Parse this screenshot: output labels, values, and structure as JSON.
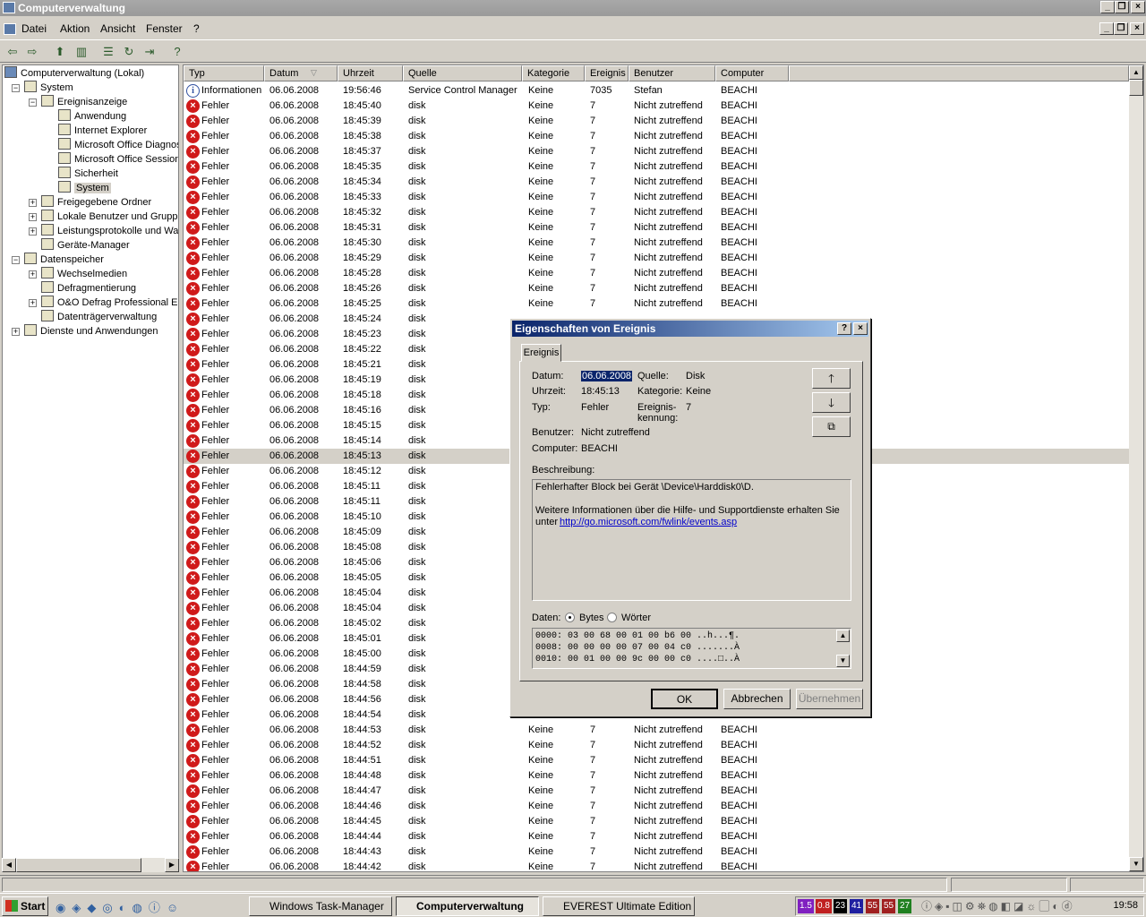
{
  "window": {
    "title": "Computerverwaltung"
  },
  "menu": [
    "Datei",
    "Aktion",
    "Ansicht",
    "Fenster",
    "?"
  ],
  "tree": {
    "root": "Computerverwaltung (Lokal)",
    "items": [
      {
        "label": "System",
        "level": 1,
        "expander": "−"
      },
      {
        "label": "Ereignisanzeige",
        "level": 2,
        "expander": "−"
      },
      {
        "label": "Anwendung",
        "level": 3
      },
      {
        "label": "Internet Explorer",
        "level": 3
      },
      {
        "label": "Microsoft Office Diagnos",
        "level": 3
      },
      {
        "label": "Microsoft Office Sessions",
        "level": 3
      },
      {
        "label": "Sicherheit",
        "level": 3
      },
      {
        "label": "System",
        "level": 3,
        "selected": true
      },
      {
        "label": "Freigegebene Ordner",
        "level": 2,
        "expander": "+"
      },
      {
        "label": "Lokale Benutzer und Gruppen",
        "level": 2,
        "expander": "+"
      },
      {
        "label": "Leistungsprotokolle und Warn",
        "level": 2,
        "expander": "+"
      },
      {
        "label": "Geräte-Manager",
        "level": 2
      },
      {
        "label": "Datenspeicher",
        "level": 1,
        "expander": "−"
      },
      {
        "label": "Wechselmedien",
        "level": 2,
        "expander": "+"
      },
      {
        "label": "Defragmentierung",
        "level": 2
      },
      {
        "label": "O&O Defrag Professional Edi",
        "level": 2,
        "expander": "+"
      },
      {
        "label": "Datenträgerverwaltung",
        "level": 2
      },
      {
        "label": "Dienste und Anwendungen",
        "level": 1,
        "expander": "+"
      }
    ]
  },
  "columns": [
    "Typ",
    "Datum",
    "Uhrzeit",
    "Quelle",
    "Kategorie",
    "Ereignis",
    "Benutzer",
    "Computer"
  ],
  "events": [
    [
      "Informationen",
      "06.06.2008",
      "19:56:46",
      "Service Control Manager",
      "Keine",
      "7035",
      "Stefan",
      "BEACHI"
    ],
    [
      "Fehler",
      "06.06.2008",
      "18:45:40",
      "disk",
      "Keine",
      "7",
      "Nicht zutreffend",
      "BEACHI"
    ],
    [
      "Fehler",
      "06.06.2008",
      "18:45:39",
      "disk",
      "Keine",
      "7",
      "Nicht zutreffend",
      "BEACHI"
    ],
    [
      "Fehler",
      "06.06.2008",
      "18:45:38",
      "disk",
      "Keine",
      "7",
      "Nicht zutreffend",
      "BEACHI"
    ],
    [
      "Fehler",
      "06.06.2008",
      "18:45:37",
      "disk",
      "Keine",
      "7",
      "Nicht zutreffend",
      "BEACHI"
    ],
    [
      "Fehler",
      "06.06.2008",
      "18:45:35",
      "disk",
      "Keine",
      "7",
      "Nicht zutreffend",
      "BEACHI"
    ],
    [
      "Fehler",
      "06.06.2008",
      "18:45:34",
      "disk",
      "Keine",
      "7",
      "Nicht zutreffend",
      "BEACHI"
    ],
    [
      "Fehler",
      "06.06.2008",
      "18:45:33",
      "disk",
      "Keine",
      "7",
      "Nicht zutreffend",
      "BEACHI"
    ],
    [
      "Fehler",
      "06.06.2008",
      "18:45:32",
      "disk",
      "Keine",
      "7",
      "Nicht zutreffend",
      "BEACHI"
    ],
    [
      "Fehler",
      "06.06.2008",
      "18:45:31",
      "disk",
      "Keine",
      "7",
      "Nicht zutreffend",
      "BEACHI"
    ],
    [
      "Fehler",
      "06.06.2008",
      "18:45:30",
      "disk",
      "Keine",
      "7",
      "Nicht zutreffend",
      "BEACHI"
    ],
    [
      "Fehler",
      "06.06.2008",
      "18:45:29",
      "disk",
      "Keine",
      "7",
      "Nicht zutreffend",
      "BEACHI"
    ],
    [
      "Fehler",
      "06.06.2008",
      "18:45:28",
      "disk",
      "Keine",
      "7",
      "Nicht zutreffend",
      "BEACHI"
    ],
    [
      "Fehler",
      "06.06.2008",
      "18:45:26",
      "disk",
      "Keine",
      "7",
      "Nicht zutreffend",
      "BEACHI"
    ],
    [
      "Fehler",
      "06.06.2008",
      "18:45:25",
      "disk",
      "Keine",
      "7",
      "Nicht zutreffend",
      "BEACHI"
    ],
    [
      "Fehler",
      "06.06.2008",
      "18:45:24",
      "disk",
      "",
      "",
      "",
      ""
    ],
    [
      "Fehler",
      "06.06.2008",
      "18:45:23",
      "disk",
      "",
      "",
      "",
      ""
    ],
    [
      "Fehler",
      "06.06.2008",
      "18:45:22",
      "disk",
      "",
      "",
      "",
      ""
    ],
    [
      "Fehler",
      "06.06.2008",
      "18:45:21",
      "disk",
      "",
      "",
      "",
      ""
    ],
    [
      "Fehler",
      "06.06.2008",
      "18:45:19",
      "disk",
      "",
      "",
      "",
      ""
    ],
    [
      "Fehler",
      "06.06.2008",
      "18:45:18",
      "disk",
      "",
      "",
      "",
      ""
    ],
    [
      "Fehler",
      "06.06.2008",
      "18:45:16",
      "disk",
      "",
      "",
      "",
      ""
    ],
    [
      "Fehler",
      "06.06.2008",
      "18:45:15",
      "disk",
      "",
      "",
      "",
      ""
    ],
    [
      "Fehler",
      "06.06.2008",
      "18:45:14",
      "disk",
      "",
      "",
      "",
      ""
    ],
    [
      "Fehler",
      "06.06.2008",
      "18:45:13",
      "disk",
      "",
      "",
      "",
      ""
    ],
    [
      "Fehler",
      "06.06.2008",
      "18:45:12",
      "disk",
      "",
      "",
      "",
      ""
    ],
    [
      "Fehler",
      "06.06.2008",
      "18:45:11",
      "disk",
      "",
      "",
      "",
      ""
    ],
    [
      "Fehler",
      "06.06.2008",
      "18:45:11",
      "disk",
      "",
      "",
      "",
      ""
    ],
    [
      "Fehler",
      "06.06.2008",
      "18:45:10",
      "disk",
      "",
      "",
      "",
      ""
    ],
    [
      "Fehler",
      "06.06.2008",
      "18:45:09",
      "disk",
      "",
      "",
      "",
      ""
    ],
    [
      "Fehler",
      "06.06.2008",
      "18:45:08",
      "disk",
      "",
      "",
      "",
      ""
    ],
    [
      "Fehler",
      "06.06.2008",
      "18:45:06",
      "disk",
      "",
      "",
      "",
      ""
    ],
    [
      "Fehler",
      "06.06.2008",
      "18:45:05",
      "disk",
      "",
      "",
      "",
      ""
    ],
    [
      "Fehler",
      "06.06.2008",
      "18:45:04",
      "disk",
      "",
      "",
      "",
      ""
    ],
    [
      "Fehler",
      "06.06.2008",
      "18:45:04",
      "disk",
      "",
      "",
      "",
      ""
    ],
    [
      "Fehler",
      "06.06.2008",
      "18:45:02",
      "disk",
      "",
      "",
      "",
      ""
    ],
    [
      "Fehler",
      "06.06.2008",
      "18:45:01",
      "disk",
      "",
      "",
      "",
      ""
    ],
    [
      "Fehler",
      "06.06.2008",
      "18:45:00",
      "disk",
      "",
      "",
      "",
      ""
    ],
    [
      "Fehler",
      "06.06.2008",
      "18:44:59",
      "disk",
      "",
      "",
      "",
      ""
    ],
    [
      "Fehler",
      "06.06.2008",
      "18:44:58",
      "disk",
      "",
      "",
      "",
      ""
    ],
    [
      "Fehler",
      "06.06.2008",
      "18:44:56",
      "disk",
      "",
      "",
      "",
      ""
    ],
    [
      "Fehler",
      "06.06.2008",
      "18:44:54",
      "disk",
      "",
      "",
      "",
      ""
    ],
    [
      "Fehler",
      "06.06.2008",
      "18:44:53",
      "disk",
      "Keine",
      "7",
      "Nicht zutreffend",
      "BEACHI"
    ],
    [
      "Fehler",
      "06.06.2008",
      "18:44:52",
      "disk",
      "Keine",
      "7",
      "Nicht zutreffend",
      "BEACHI"
    ],
    [
      "Fehler",
      "06.06.2008",
      "18:44:51",
      "disk",
      "Keine",
      "7",
      "Nicht zutreffend",
      "BEACHI"
    ],
    [
      "Fehler",
      "06.06.2008",
      "18:44:48",
      "disk",
      "Keine",
      "7",
      "Nicht zutreffend",
      "BEACHI"
    ],
    [
      "Fehler",
      "06.06.2008",
      "18:44:47",
      "disk",
      "Keine",
      "7",
      "Nicht zutreffend",
      "BEACHI"
    ],
    [
      "Fehler",
      "06.06.2008",
      "18:44:46",
      "disk",
      "Keine",
      "7",
      "Nicht zutreffend",
      "BEACHI"
    ],
    [
      "Fehler",
      "06.06.2008",
      "18:44:45",
      "disk",
      "Keine",
      "7",
      "Nicht zutreffend",
      "BEACHI"
    ],
    [
      "Fehler",
      "06.06.2008",
      "18:44:44",
      "disk",
      "Keine",
      "7",
      "Nicht zutreffend",
      "BEACHI"
    ],
    [
      "Fehler",
      "06.06.2008",
      "18:44:43",
      "disk",
      "Keine",
      "7",
      "Nicht zutreffend",
      "BEACHI"
    ],
    [
      "Fehler",
      "06.06.2008",
      "18:44:42",
      "disk",
      "Keine",
      "7",
      "Nicht zutreffend",
      "BEACHI"
    ]
  ],
  "dialog": {
    "title": "Eigenschaften von Ereignis",
    "tab": "Ereignis",
    "datum_label": "Datum:",
    "datum": "06.06.2008",
    "quelle_label": "Quelle:",
    "quelle": "Disk",
    "uhrzeit_label": "Uhrzeit:",
    "uhrzeit": "18:45:13",
    "kategorie_label": "Kategorie:",
    "kategorie": "Keine",
    "typ_label": "Typ:",
    "typ": "Fehler",
    "kennung_label1": "Ereignis-",
    "kennung_label2": "kennung:",
    "kennung": "7",
    "benutzer_label": "Benutzer:",
    "benutzer": "Nicht zutreffend",
    "computer_label": "Computer:",
    "computer": "BEACHI",
    "beschreibung_label": "Beschreibung:",
    "desc_line1": "Fehlerhafter Block bei Gerät \\Device\\Harddisk0\\D.",
    "desc_line2": "Weitere Informationen über die Hilfe- und Supportdienste erhalten Sie",
    "desc_line3": "unter",
    "desc_link": "http://go.microsoft.com/fwlink/events.asp",
    "daten_label": "Daten:",
    "radio_bytes": "Bytes",
    "radio_woerter": "Wörter",
    "hex": [
      "0000: 03 00 68 00 01 00 b6 00   ..h...¶.",
      "0008: 00 00 00 00 07 00 04 c0   .......À",
      "0010: 00 01 00 00 9c 00 00 c0   ....□..À"
    ],
    "ok": "OK",
    "cancel": "Abbrechen",
    "apply": "Übernehmen"
  },
  "taskbar": {
    "start": "Start",
    "buttons": [
      "Windows Task-Manager",
      "Computerverwaltung",
      "EVEREST Ultimate Edition"
    ],
    "tray_values": [
      "1.5",
      "0.8",
      "23",
      "41",
      "55",
      "55",
      "27"
    ],
    "clock": "19:58"
  }
}
